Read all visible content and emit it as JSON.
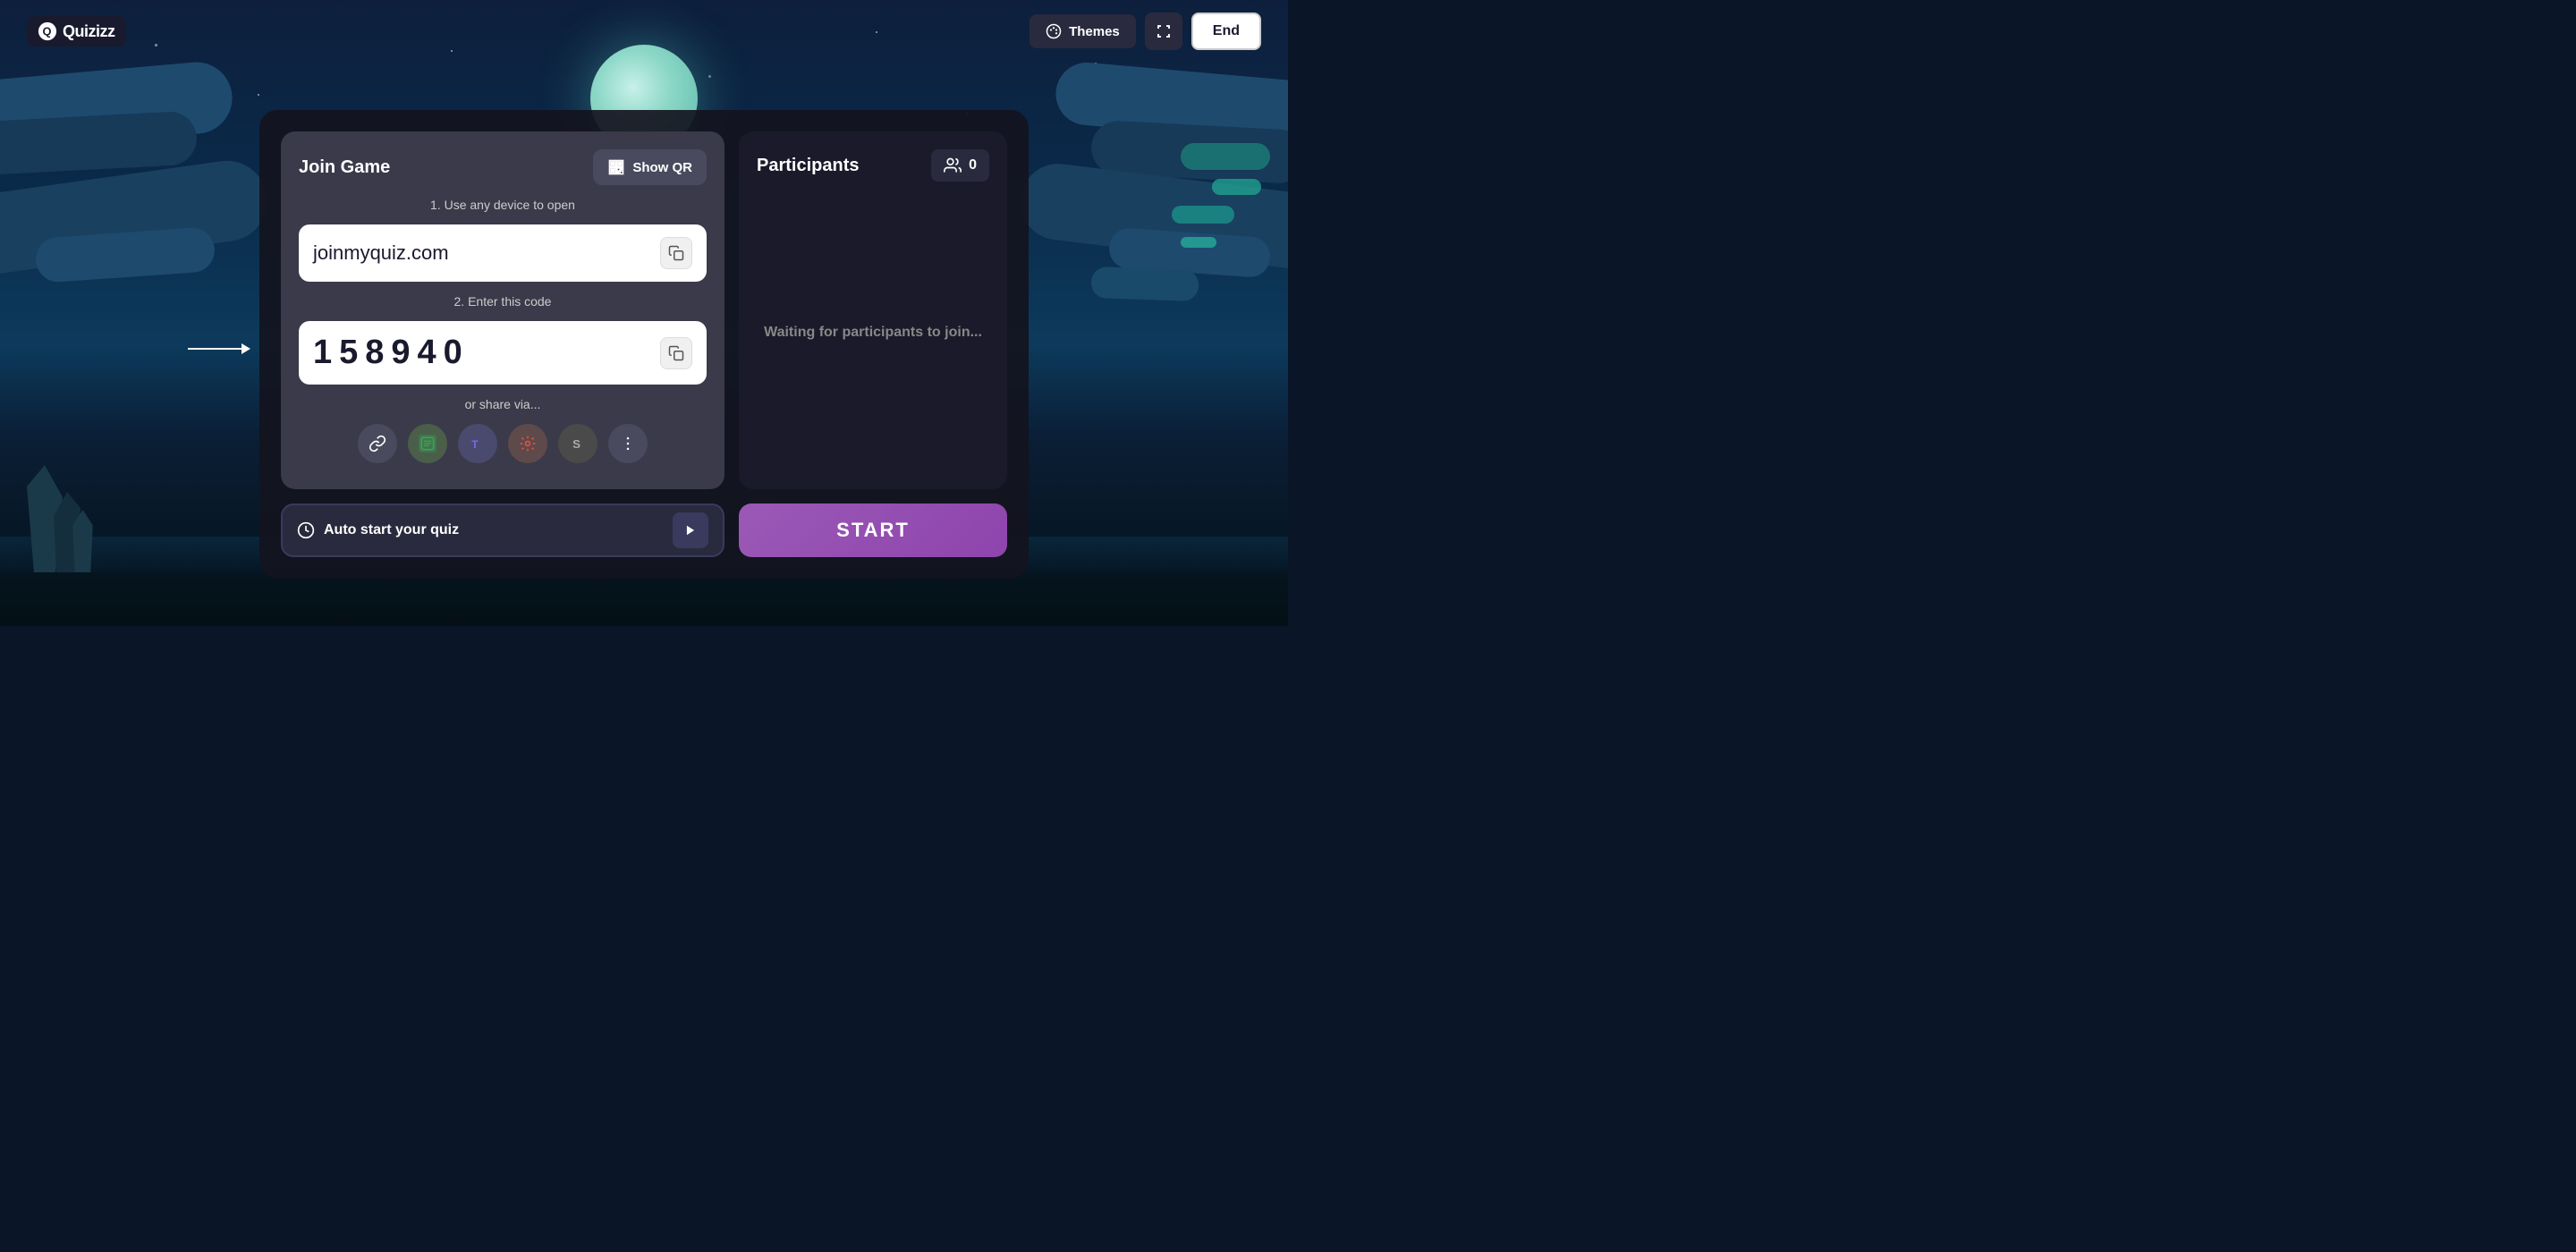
{
  "app": {
    "logo_text": "Quizizz"
  },
  "header": {
    "themes_label": "Themes",
    "end_label": "End"
  },
  "join_game": {
    "title": "Join Game",
    "show_qr_label": "Show QR",
    "step1_text": "1. Use any device to open",
    "url": "joinmyquiz.com",
    "step2_text": "2. Enter this code",
    "code": "158940",
    "share_text": "or share via...",
    "share_icons": [
      {
        "name": "link-icon",
        "symbol": "🔗"
      },
      {
        "name": "classroom-icon",
        "symbol": "📗"
      },
      {
        "name": "teams-icon",
        "symbol": "T"
      },
      {
        "name": "canvas-icon",
        "symbol": "⚙"
      },
      {
        "name": "schoology-icon",
        "symbol": "S"
      },
      {
        "name": "more-icon",
        "symbol": "⋮"
      }
    ]
  },
  "participants": {
    "title": "Participants",
    "count": "0",
    "waiting_text": "Waiting for participants to join..."
  },
  "bottom": {
    "auto_start_label": "Auto start your quiz",
    "start_label": "START"
  },
  "colors": {
    "start_btn": "#9b59b6",
    "background_dark": "#0d1f3c"
  }
}
